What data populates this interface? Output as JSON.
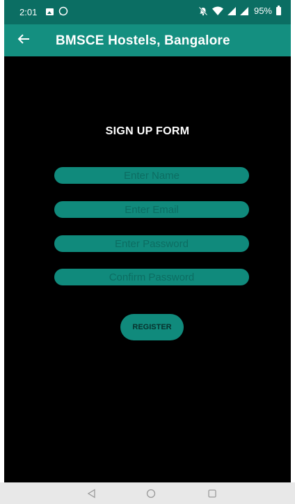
{
  "status_bar": {
    "time": "2:01",
    "battery": "95%",
    "icons": [
      "image-icon",
      "whatsapp-icon",
      "mute-icon",
      "wifi-icon",
      "signal-icon",
      "signal-icon",
      "battery-icon"
    ]
  },
  "app_bar": {
    "back_icon": "arrow-left-icon",
    "title": "BMSCE Hostels, Bangalore"
  },
  "form": {
    "title": "SIGN UP FORM",
    "name_placeholder": "Enter Name",
    "email_placeholder": "Enter Email",
    "password_placeholder": "Enter Password",
    "confirm_placeholder": "Confirm Password",
    "register_label": "REGISTER"
  },
  "nav_bar": {
    "icons": [
      "nav-back-icon",
      "nav-home-icon",
      "nav-recent-icon"
    ]
  },
  "colors": {
    "status_bar": "#0b6e63",
    "app_bar": "#148f80",
    "field": "#108a7c",
    "background": "#000000",
    "nav_bar": "#e8e8e8"
  }
}
